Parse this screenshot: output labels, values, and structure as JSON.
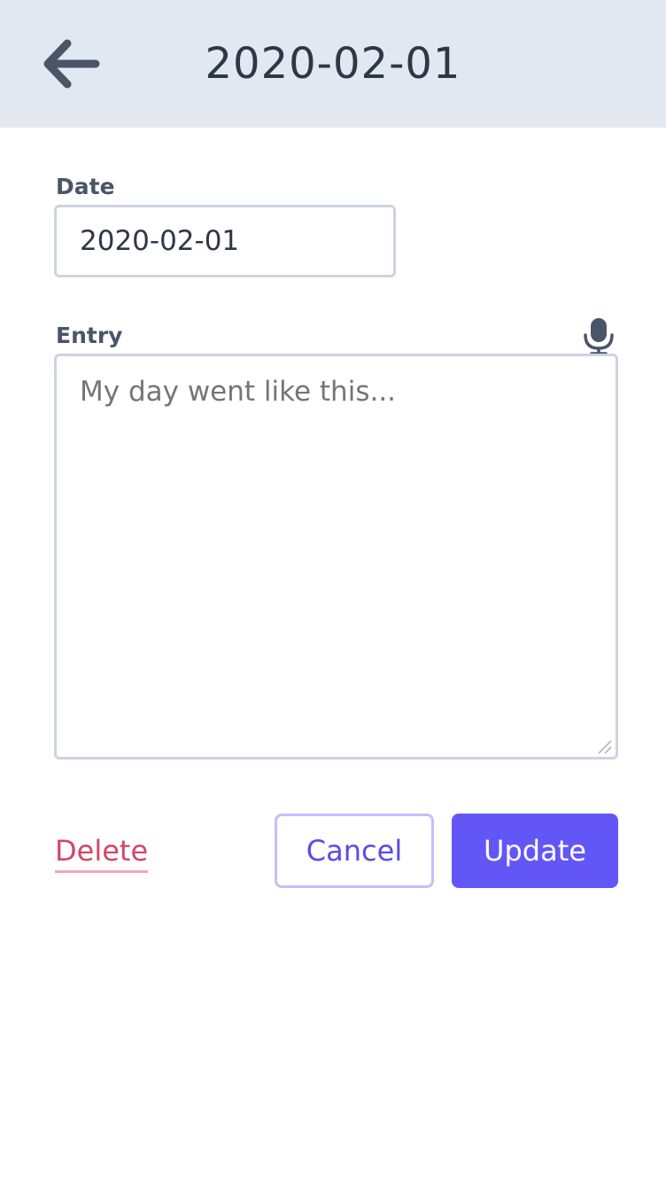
{
  "header": {
    "title": "2020-02-01",
    "back_icon": "arrow-left-icon",
    "background_color": "#e2e8f0"
  },
  "form": {
    "date": {
      "label": "Date",
      "value": "2020-02-01"
    },
    "entry": {
      "label": "Entry",
      "value": "",
      "placeholder": "My day went like this...",
      "mic_icon": "microphone-icon"
    }
  },
  "actions": {
    "delete_label": "Delete",
    "cancel_label": "Cancel",
    "update_label": "Update",
    "delete_color": "#d14867",
    "primary_color": "#6356f6"
  }
}
